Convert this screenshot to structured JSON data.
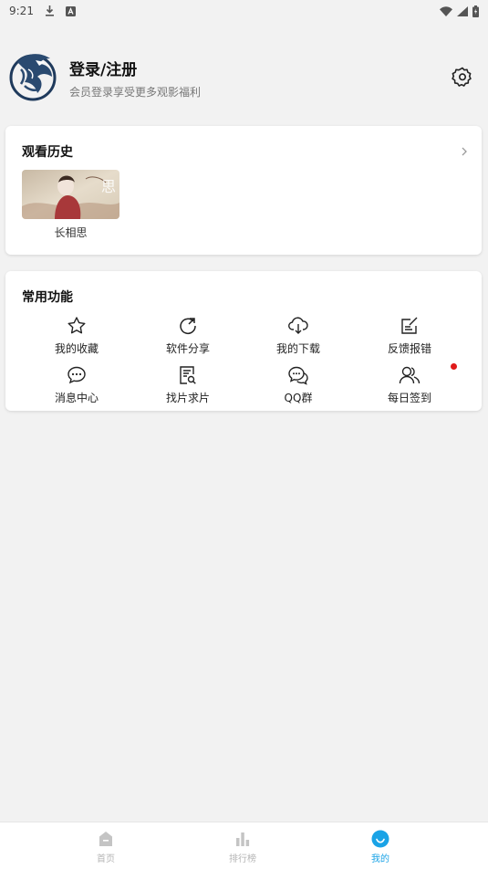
{
  "status_bar": {
    "time": "9:21",
    "icons": [
      "download-icon",
      "font-a-icon",
      "wifi-icon",
      "signal-icon",
      "battery-icon"
    ]
  },
  "profile": {
    "title": "登录/注册",
    "subtitle": "会员登录享受更多观影福利",
    "avatar_icon": "eagle-logo",
    "settings_icon": "gear-icon"
  },
  "history": {
    "title": "观看历史",
    "more_icon": "chevron-right-icon",
    "items": [
      {
        "label": "长相思",
        "poster_glyph": "思"
      }
    ]
  },
  "functions": {
    "title": "常用功能",
    "items": [
      {
        "label": "我的收藏",
        "icon": "star-icon"
      },
      {
        "label": "软件分享",
        "icon": "share-refresh-icon"
      },
      {
        "label": "我的下载",
        "icon": "cloud-download-icon"
      },
      {
        "label": "反馈报错",
        "icon": "edit-feedback-icon"
      },
      {
        "label": "消息中心",
        "icon": "message-icon"
      },
      {
        "label": "找片求片",
        "icon": "doc-search-icon"
      },
      {
        "label": "QQ群",
        "icon": "chat-bubbles-icon"
      },
      {
        "label": "每日签到",
        "icon": "users-icon"
      }
    ]
  },
  "tabbar": {
    "tabs": [
      {
        "label": "首页",
        "icon": "home-icon",
        "active": false
      },
      {
        "label": "排行榜",
        "icon": "bar-chart-icon",
        "active": false
      },
      {
        "label": "我的",
        "icon": "smile-icon",
        "active": true
      }
    ],
    "active_color": "#1aa3e6",
    "inactive_color": "#b5b5b5"
  }
}
